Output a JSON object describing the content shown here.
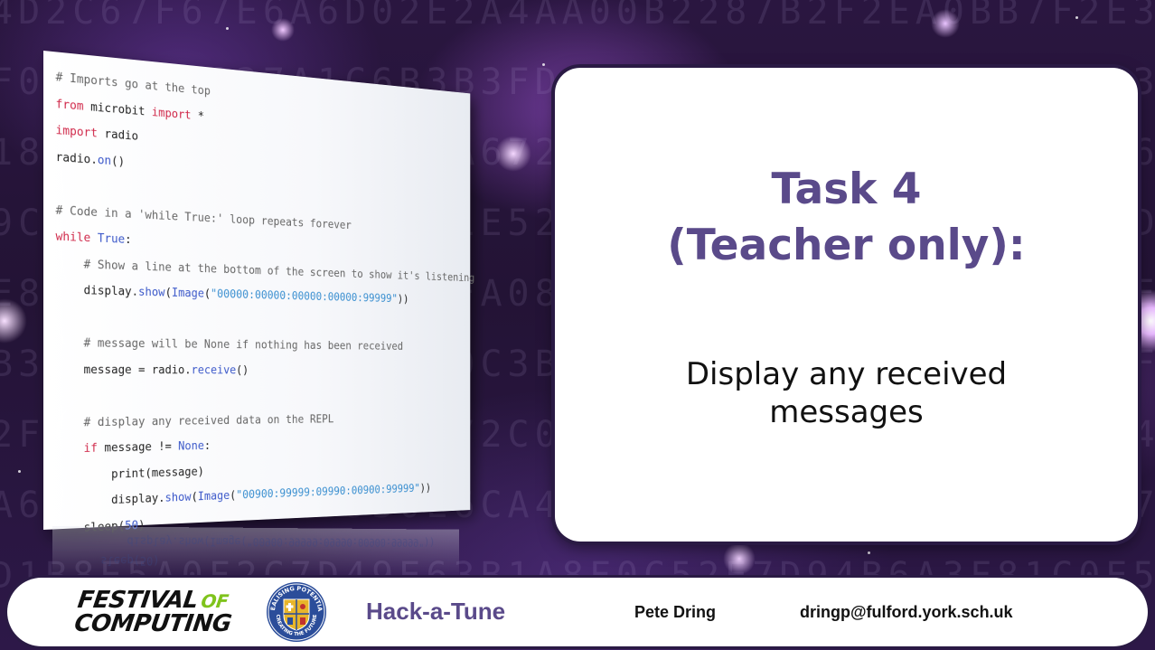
{
  "background": {
    "hex_rows": [
      "4D2C67F67E6A6D02E2A4AA00B2287B2F2EA0BB7F2E3D",
      "F07BC0EA837A1C6B3B3FD2609823CA07E25BAD1C6B3F01",
      "18A3F92C7FE0A8576A672560BDE8F34EC98A2B7FD06A5",
      "9C21FE8B36D4A7F0C1E52B8A49D3F7E06C2A815B9ED43",
      "E8C2F0A957B31D6E4FA082C7B9D5E13A6F0C84B2D7E91",
      "B3A7F9C2E85D1A4F60C3B9E7D28A5F1C0E6B4D9A73F2",
      "2F84C0EB9D316A5FE72C0B8D4A9E13F6C5B27D0E8A4F",
      "A6E4C18D5B2F7930E6CA41B8D7F25E03A9C6B1D84F7E",
      "D1B8E5A0F2C7D49E63B1A8F0C52E7D94B6A3F81C0E5"
    ]
  },
  "code": {
    "lines": [
      [
        {
          "t": "# Imports go at the top",
          "c": "cm"
        }
      ],
      [
        {
          "t": "from",
          "c": "kw"
        },
        {
          "t": " microbit ",
          "c": ""
        },
        {
          "t": "import",
          "c": "kw"
        },
        {
          "t": " *",
          "c": ""
        }
      ],
      [
        {
          "t": "import",
          "c": "kw"
        },
        {
          "t": " radio",
          "c": ""
        }
      ],
      [
        {
          "t": "radio.",
          "c": ""
        },
        {
          "t": "on",
          "c": "fn"
        },
        {
          "t": "()",
          "c": ""
        }
      ],
      [
        {
          "t": "",
          "c": ""
        }
      ],
      [
        {
          "t": "# Code in a 'while True:' loop repeats forever",
          "c": "cm"
        }
      ],
      [
        {
          "t": "while",
          "c": "kw"
        },
        {
          "t": " ",
          "c": ""
        },
        {
          "t": "True",
          "c": "fn"
        },
        {
          "t": ":",
          "c": ""
        }
      ],
      [
        {
          "t": "    # Show a line at the bottom of the screen to show it's listening",
          "c": "cm"
        }
      ],
      [
        {
          "t": "    display.",
          "c": ""
        },
        {
          "t": "show",
          "c": "fn"
        },
        {
          "t": "(",
          "c": ""
        },
        {
          "t": "Image",
          "c": "fn"
        },
        {
          "t": "(",
          "c": ""
        },
        {
          "t": "\"00000:00000:00000:00000:99999\"",
          "c": "st"
        },
        {
          "t": "))",
          "c": ""
        }
      ],
      [
        {
          "t": "",
          "c": ""
        }
      ],
      [
        {
          "t": "    # message will be None if nothing has been received",
          "c": "cm"
        }
      ],
      [
        {
          "t": "    message = radio.",
          "c": ""
        },
        {
          "t": "receive",
          "c": "fn"
        },
        {
          "t": "()",
          "c": ""
        }
      ],
      [
        {
          "t": "",
          "c": ""
        }
      ],
      [
        {
          "t": "    # display any received data on the REPL",
          "c": "cm"
        }
      ],
      [
        {
          "t": "    ",
          "c": ""
        },
        {
          "t": "if",
          "c": "kw"
        },
        {
          "t": " message != ",
          "c": ""
        },
        {
          "t": "None",
          "c": "fn"
        },
        {
          "t": ":",
          "c": ""
        }
      ],
      [
        {
          "t": "        print(message)",
          "c": ""
        }
      ],
      [
        {
          "t": "        display.",
          "c": ""
        },
        {
          "t": "show",
          "c": "fn"
        },
        {
          "t": "(",
          "c": ""
        },
        {
          "t": "Image",
          "c": "fn"
        },
        {
          "t": "(",
          "c": ""
        },
        {
          "t": "\"00900:99999:09990:00900:99999\"",
          "c": "st"
        },
        {
          "t": "))",
          "c": ""
        }
      ],
      [
        {
          "t": "    sleep(",
          "c": ""
        },
        {
          "t": "50",
          "c": "nm"
        },
        {
          "t": ")",
          "c": ""
        }
      ]
    ],
    "reflection": "  sleep(50)\n      display.show(Image(\"00900:99999:09990:00900:99999\"))"
  },
  "task": {
    "title_line1": "Task 4",
    "title_line2": "(Teacher only):",
    "desc_line1": "Display any received",
    "desc_line2": "messages"
  },
  "footer": {
    "logo_line1": "FESTIVAL",
    "logo_of": "OF",
    "logo_line2": "COMPUTING",
    "badge_top_text": "REALISING POTENTIAL",
    "badge_bottom_text": "CREATING THE FUTURE",
    "project": "Hack-a-Tune",
    "presenter": "Pete Dring",
    "email": "dringp@fulford.york.sch.uk"
  },
  "colors": {
    "accent_purple": "#5a4a8a",
    "logo_green": "#7fc31c",
    "badge_blue": "#2b4d9a",
    "badge_gold": "#e8b52a"
  }
}
